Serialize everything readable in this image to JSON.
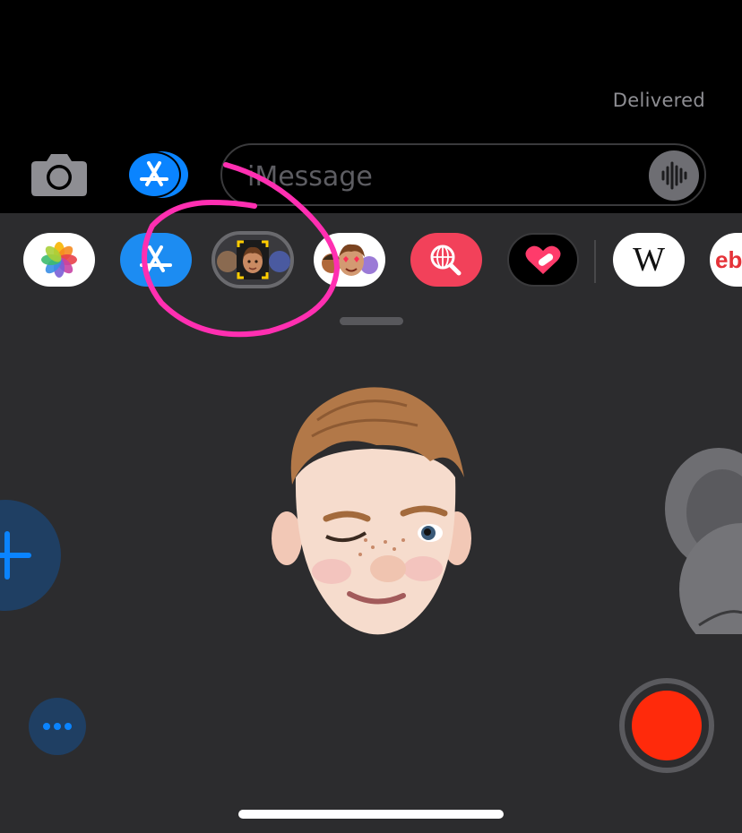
{
  "status": {
    "delivered": "Delivered"
  },
  "compose": {
    "placeholder": "iMessage"
  },
  "app_drawer": {
    "apps": [
      {
        "name": "Photos",
        "icon": "photos-icon",
        "bg": "#ffffff"
      },
      {
        "name": "App Store",
        "icon": "app-store-icon",
        "bg": "#1c8cf2"
      },
      {
        "name": "Memoji Stickers (selected)",
        "icon": "memoji-camera-icon",
        "bg": "#4a4a4e"
      },
      {
        "name": "Memoji Stickers",
        "icon": "memoji-stickers-icon",
        "bg": "#ffffff"
      },
      {
        "name": "Web Images",
        "icon": "web-search-icon",
        "bg": "#f2415a"
      },
      {
        "name": "Digital Touch",
        "icon": "digital-touch-heart-icon",
        "bg": "#000000"
      },
      {
        "name": "Wikipedia",
        "icon": "wikipedia-icon",
        "bg": "#ffffff",
        "label": "W"
      },
      {
        "name": "eBay",
        "icon": "ebay-icon",
        "bg": "#ffffff",
        "label": "eb"
      }
    ]
  },
  "colors": {
    "accent_blue": "#0a84ff",
    "record_red": "#ff2a0b",
    "annotation_pink": "#ff2fb1"
  }
}
